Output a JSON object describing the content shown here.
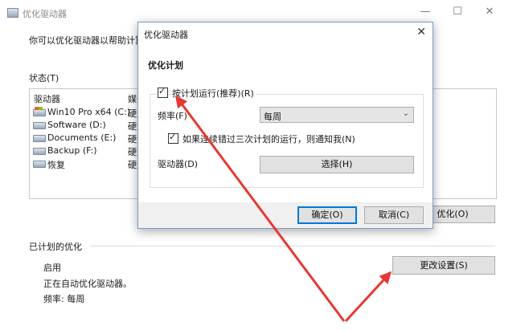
{
  "main_window": {
    "title": "优化驱动器",
    "description": "你可以优化驱动器以帮助计算机",
    "status_label": "状态(T)",
    "columns": {
      "drive": "驱动器",
      "media": "媒体"
    },
    "drives": [
      {
        "label": "Win10 Pro x64 (C:)",
        "media": "硬盘",
        "icon": "system-drive-icon"
      },
      {
        "label": "Software (D:)",
        "media": "硬盘",
        "icon": "drive-icon"
      },
      {
        "label": "Documents (E:)",
        "media": "硬盘",
        "icon": "drive-icon"
      },
      {
        "label": "Backup (F:)",
        "media": "硬盘",
        "icon": "drive-icon"
      },
      {
        "label": "恢复",
        "media": "硬盘",
        "icon": "drive-icon"
      }
    ],
    "optimize_button": "优化(O)",
    "scheduled_section": "已计划的优化",
    "schedule_state": "启用",
    "schedule_running": "正在自动优化驱动器。",
    "frequency_text": "频率: 每周",
    "change_settings_button": "更改设置(S)",
    "window_controls": {
      "minimize": "—",
      "maximize": "☐",
      "close": "✕"
    }
  },
  "dialog": {
    "title": "优化驱动器",
    "close": "✕",
    "heading": "优化计划",
    "run_on_schedule": {
      "label": "按计划运行(推荐)(R)",
      "checked": true
    },
    "frequency_label": "频率(F)",
    "frequency_value": "每周",
    "notify": {
      "label": "如果连续错过三次计划的运行，则通知我(N)",
      "checked": true
    },
    "drives_label": "驱动器(D)",
    "choose_button": "选择(H)",
    "ok_button": "确定(O)",
    "cancel_button": "取消(C)"
  },
  "annotation_color": "#e53935"
}
